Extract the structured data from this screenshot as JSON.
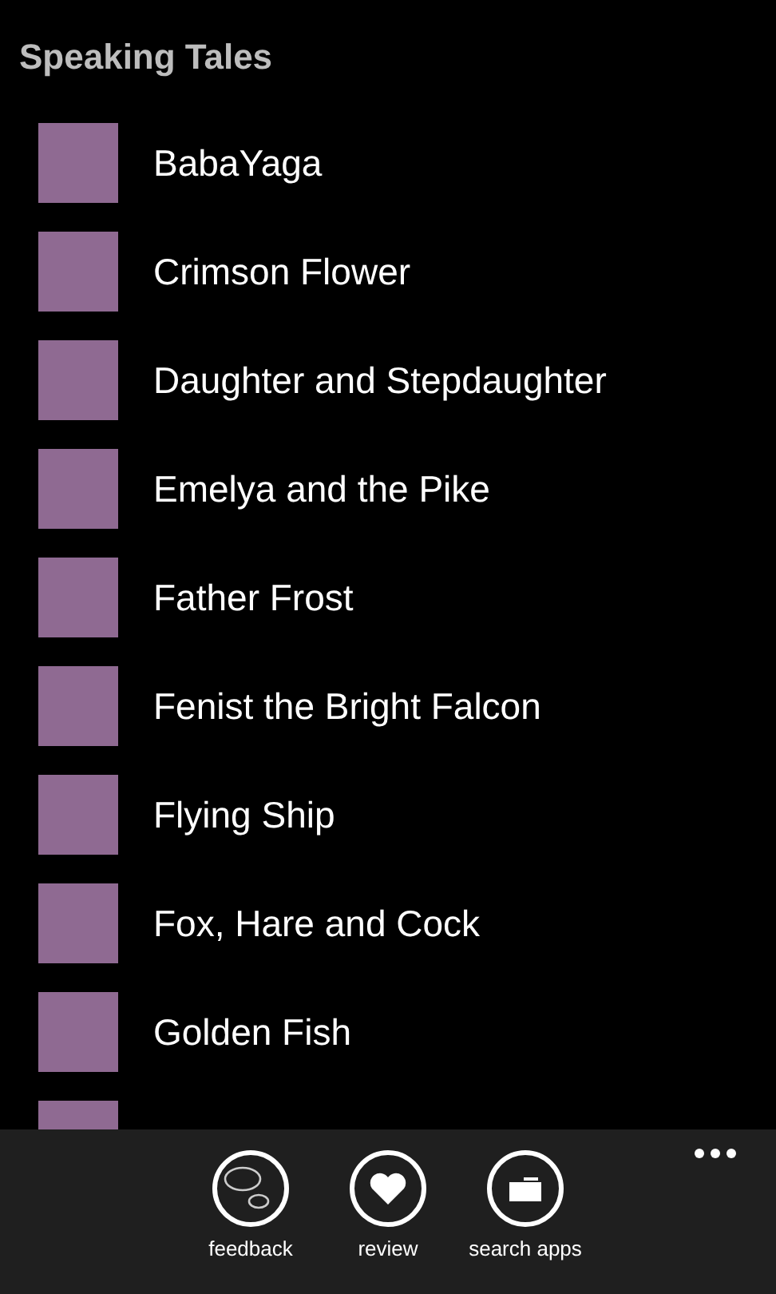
{
  "app": {
    "title": "Speaking Tales"
  },
  "tales": [
    {
      "kind": "tale",
      "title": "BabaYaga"
    },
    {
      "kind": "tale",
      "title": "Crimson Flower"
    },
    {
      "kind": "tale",
      "title": "Daughter and Stepdaughter"
    },
    {
      "kind": "tale",
      "title": "Emelya and the Pike"
    },
    {
      "kind": "tale",
      "title": "Father Frost"
    },
    {
      "kind": "tale",
      "title": "Fenist the Bright Falcon"
    },
    {
      "kind": "tale",
      "title": "Flying Ship"
    },
    {
      "kind": "tale",
      "title": "Fox, Hare and Cock"
    },
    {
      "kind": "tale",
      "title": "Golden Fish"
    },
    {
      "kind": "cut"
    }
  ],
  "app_bar": {
    "buttons": [
      {
        "kind": "feedback",
        "label": "feedback"
      },
      {
        "kind": "review",
        "label": "review"
      },
      {
        "kind": "search",
        "label": "search apps"
      }
    ]
  }
}
